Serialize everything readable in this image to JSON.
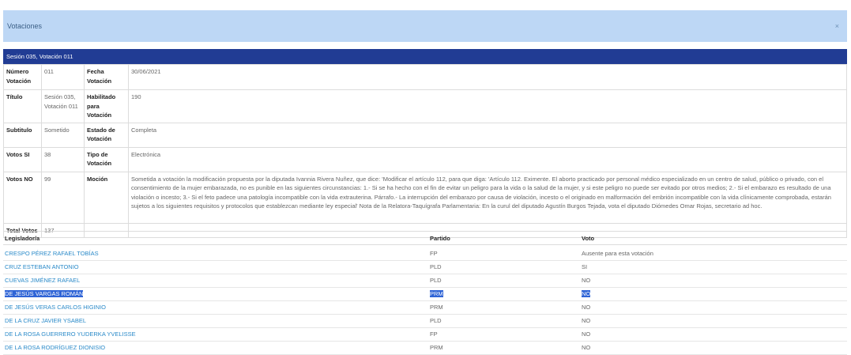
{
  "modal": {
    "title": "Votaciones",
    "close": "×"
  },
  "session_header": "Sesión 035, Votación 011",
  "details": {
    "numero_label": "Número Votación",
    "numero_value": "011",
    "fecha_label": "Fecha Votación",
    "fecha_value": "30/06/2021",
    "titulo_label": "Título",
    "titulo_value": "Sesión 035, Votación 011",
    "habilitado_label": "Habilitado para Votación",
    "habilitado_value": "190",
    "subtitulo_label": "Subtitulo",
    "subtitulo_value": "Sometido",
    "estado_label": "Estado de Votación",
    "estado_value": "Completa",
    "votos_si_label": "Votos SI",
    "votos_si_value": "38",
    "tipo_label": "Tipo de Votación",
    "tipo_value": "Electrónica",
    "votos_no_label": "Votos NO",
    "votos_no_value": "99",
    "mocion_label": "Moción",
    "mocion_value": "Sometida a votación la modificación propuesta por la diputada Ivannia Rivera Nuñez, que dice: 'Modificar el artículo 112, para que diga: 'Artículo 112. Eximente. El aborto practicado por personal médico especializado en un centro de salud, público o privado, con el consentimiento de la mujer embarazada, no es punible en las siguientes circunstancias: 1.- Si se ha hecho con el fin de evitar un peligro para la vida o la salud de la mujer, y si este peligro no puede ser evitado por otros medios; 2.- Si el embarazo es resultado de una violación o incesto; 3.- Si el feto padece una patología incompatible con la vida extrauterina. Párrafo.- La interrupción del embarazo por causa de violación, incesto o el originado en malformación del embrión incompatible con la vida clínicamente comprobada, estarán sujetos a los siguientes requisitos y protocolos que establezcan mediante ley especial' Nota de la Relatora-Taquígrafa Parlamentaria: En la curul del diputado Agustín Burgos Tejada, vota el diputado Diómedes Omar Rojas, secretario ad hoc.",
    "total_label": "Total Votos",
    "total_value": "137"
  },
  "legislators_table": {
    "headers": {
      "name": "Legislador/a",
      "party": "Partido",
      "vote": "Voto"
    },
    "rows": [
      {
        "name": "CRESPO PÉREZ RAFAEL TOBÍAS",
        "party": "FP",
        "vote": "Ausente para esta votación"
      },
      {
        "name": "CRUZ ESTEBAN ANTONIO",
        "party": "PLD",
        "vote": "SI"
      },
      {
        "name": "CUEVAS JIMÉNEZ RAFAEL",
        "party": "PLD",
        "vote": "NO"
      },
      {
        "name": "DE JESÚS VARGAS ROMÁN",
        "party": "PRM",
        "vote": "NO"
      },
      {
        "name": "DE JESÚS VERAS CARLOS HIGINIO",
        "party": "PRM",
        "vote": "NO"
      },
      {
        "name": "DE LA CRUZ JAVIER YSABEL",
        "party": "PLD",
        "vote": "NO"
      },
      {
        "name": "DE LA ROSA GUERRERO YUDERKA YVELISSE",
        "party": "FP",
        "vote": "NO"
      },
      {
        "name": "DE LA ROSA RODRÍGUEZ DIONISIO",
        "party": "PRM",
        "vote": "NO"
      }
    ]
  }
}
